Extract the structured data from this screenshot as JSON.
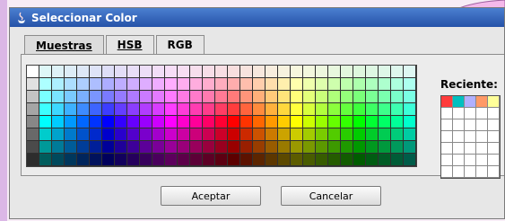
{
  "window": {
    "title": "Seleccionar Color"
  },
  "tabs": [
    {
      "label": "Muestras",
      "active": true
    },
    {
      "label": "HSB",
      "active": false
    },
    {
      "label": "RGB",
      "active": false
    }
  ],
  "recent": {
    "label": "Reciente:",
    "colors": [
      "#ff3b3b",
      "#00c0c0",
      "#b0b0ff",
      "#ff9966",
      "#ffff99"
    ]
  },
  "buttons": {
    "accept": "Aceptar",
    "cancel": "Cancelar"
  },
  "theme": {
    "titlebar_blue": "#2552a8"
  }
}
